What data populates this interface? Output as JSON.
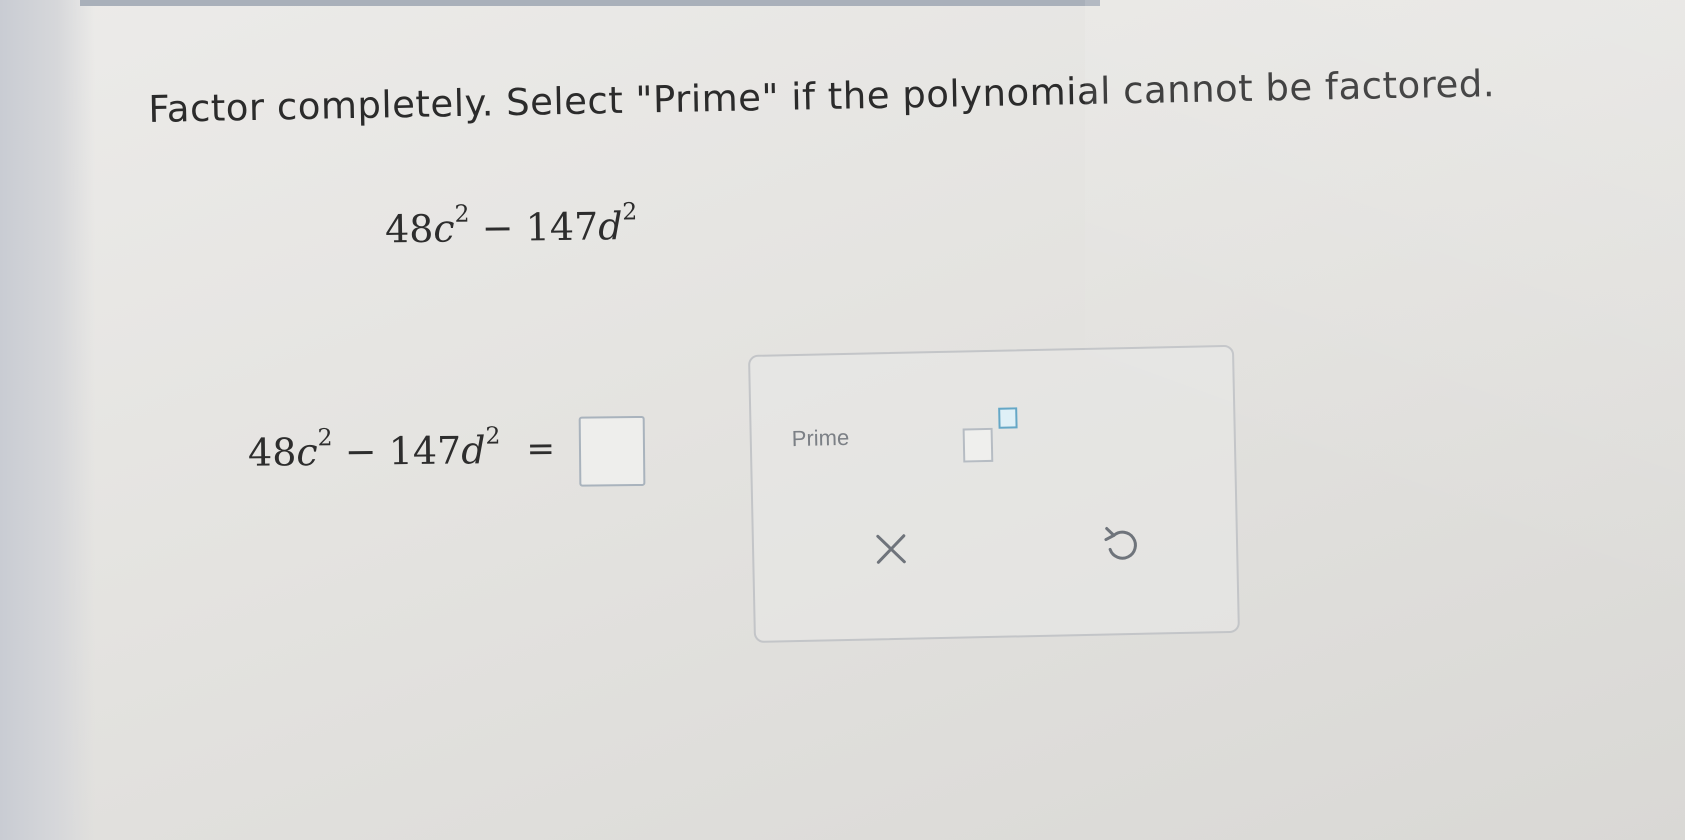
{
  "question": {
    "instruction": "Factor completely. Select \"Prime\" if the polynomial cannot be factored."
  },
  "polynomial": {
    "coef1": "48",
    "var1": "c",
    "exp1": "2",
    "minus": "−",
    "coef2": "147",
    "var2": "d",
    "exp2": "2"
  },
  "equation": {
    "equals": "="
  },
  "palette": {
    "prime_label": "Prime",
    "icons": {
      "exponent": "superscript-template-icon",
      "clear": "close-icon",
      "undo": "undo-icon"
    }
  }
}
